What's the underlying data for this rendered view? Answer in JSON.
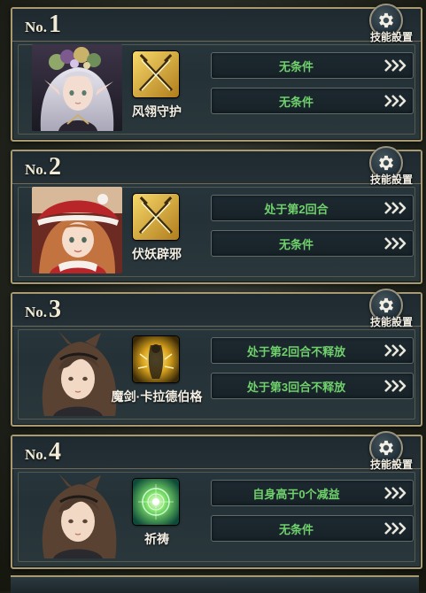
{
  "skill_setting_label": "技能設置",
  "rank_prefix": "No.",
  "cards": [
    {
      "rank": "1",
      "skill_name": "风翎守护",
      "conditions": [
        "无条件",
        "无条件"
      ]
    },
    {
      "rank": "2",
      "skill_name": "伏妖辟邪",
      "conditions": [
        "处于第2回合",
        "无条件"
      ]
    },
    {
      "rank": "3",
      "skill_name": "魔剑·卡拉德伯格",
      "conditions": [
        "处于第2回合不释放",
        "处于第3回合不释放"
      ]
    },
    {
      "rank": "4",
      "skill_name": "祈祷",
      "conditions": [
        "自身高于0个减益",
        "无条件"
      ]
    }
  ],
  "colors": {
    "frame_gold": "#a99a72",
    "condition_text": "#6fd16b",
    "panel": "#243238"
  }
}
